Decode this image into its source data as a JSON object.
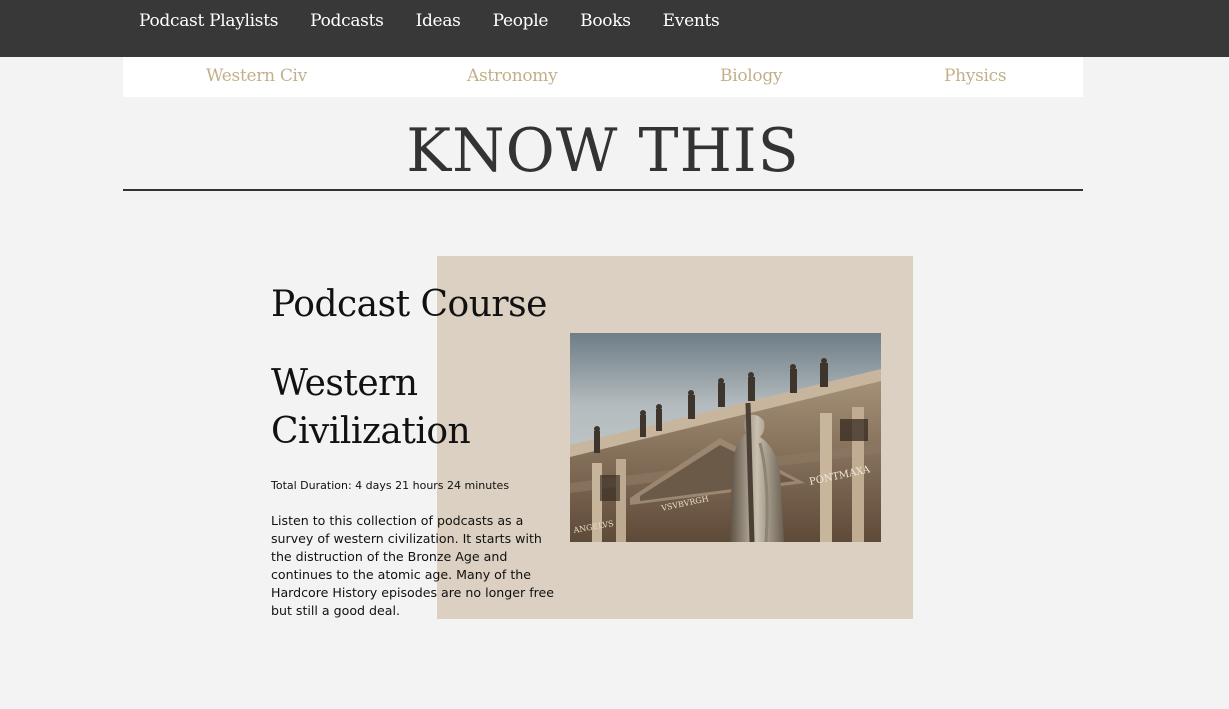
{
  "nav": {
    "items": [
      {
        "label": "Podcast Playlists"
      },
      {
        "label": "Podcasts"
      },
      {
        "label": "Ideas"
      },
      {
        "label": "People"
      },
      {
        "label": "Books"
      },
      {
        "label": "Events"
      }
    ]
  },
  "subnav": {
    "items": [
      {
        "label": "Western Civ"
      },
      {
        "label": "Astronomy"
      },
      {
        "label": "Biology"
      },
      {
        "label": "Physics"
      }
    ]
  },
  "site": {
    "title": "KNOW THIS"
  },
  "course": {
    "type": "Podcast Course",
    "title": "Western Civilization",
    "duration": "Total Duration: 4 days 21 hours 24 minutes",
    "description": "Listen to this collection of podcasts as a survey of western civilization. It starts with the distruction of the Bronze Age and continues to the atomic age. Many of the Hardcore History episodes are no longer free but still a good deal.",
    "image": {
      "subject": "st-peters-basilica-statue-photo",
      "inscriptions": [
        "PONTMAXA",
        "VSVBVRGH",
        "ANGELVS"
      ]
    }
  },
  "colors": {
    "nav_bg": "#383838",
    "accent": "#c2b08a",
    "panel": "#dbd0c1",
    "page_bg": "#f3f3f3"
  }
}
